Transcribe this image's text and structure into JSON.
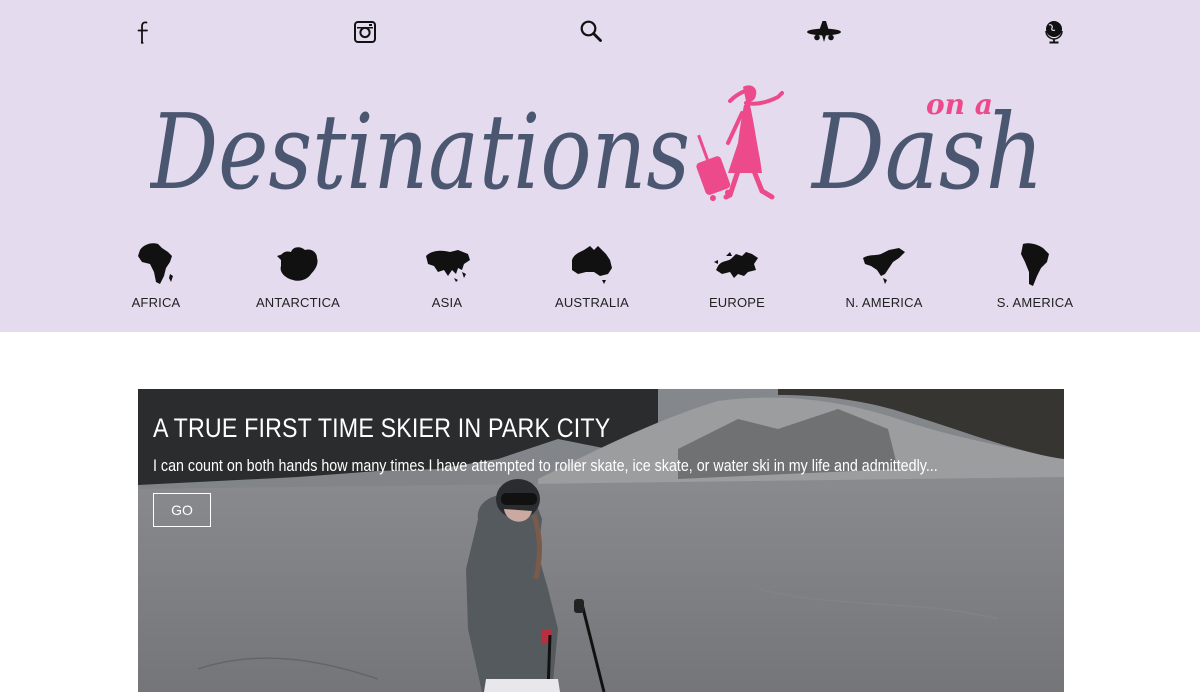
{
  "header": {
    "background": "#e4dbee",
    "social_icons": [
      "facebook-icon",
      "instagram-icon",
      "search-icon",
      "airplane-icon",
      "globe-icon"
    ],
    "logo": {
      "text_main": "Destinations",
      "text_small": "on a",
      "text_end": "Dash",
      "main_color": "#4b5670",
      "accent_color": "#ec4a8a"
    },
    "continents": [
      {
        "label": "AFRICA"
      },
      {
        "label": "ANTARCTICA"
      },
      {
        "label": "ASIA"
      },
      {
        "label": "AUSTRALIA"
      },
      {
        "label": "EUROPE"
      },
      {
        "label": "N. AMERICA"
      },
      {
        "label": "S. AMERICA"
      }
    ]
  },
  "featured": {
    "title": "A TRUE FIRST TIME SKIER IN PARK CITY",
    "excerpt": "I can count on both hands how many times I have attempted to roller skate, ice skate, or water ski in my life and admittedly...",
    "button_label": "GO"
  }
}
